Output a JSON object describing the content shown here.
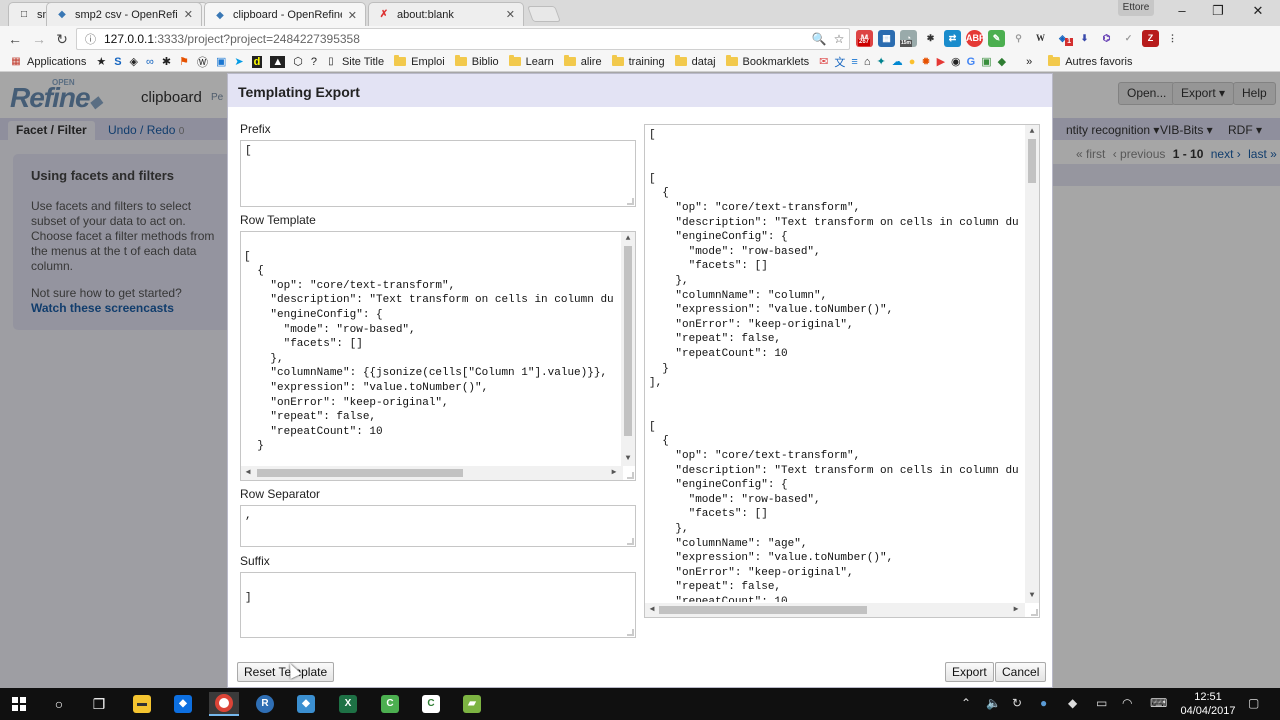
{
  "browser": {
    "tabs": [
      {
        "title": "smp2 csv - OpenRefine",
        "active": false
      },
      {
        "title": "clipboard - OpenRefine",
        "active": true
      },
      {
        "title": "about:blank",
        "active": false
      }
    ],
    "user": "Ettore",
    "url_host": "127.0.0.1",
    "url_rest": ":3333/project?project=2484227395358",
    "bookmarks_apps": "Applications",
    "bookmarks": [
      "Site Title",
      "Emploi",
      "Biblio",
      "Learn",
      "alire",
      "training",
      "dataj",
      "Bookmarklets"
    ],
    "bookmarks_more": "»",
    "bookmarks_other": "Autres favoris",
    "gmail_badge": "267",
    "ext_badge_15m": "15m",
    "ext_badge_1": "1"
  },
  "openrefine": {
    "logo": "Refine",
    "logo_top": "OPEN",
    "project_name": "clipboard",
    "permalink": "Pe",
    "header_buttons": {
      "open": "Open...",
      "export": "Export",
      "help": "Help"
    },
    "left_tabs": {
      "facet": "Facet / Filter",
      "undo": "Undo / Redo",
      "undo_count": "0"
    },
    "column_menus": [
      "ntity recognition",
      "VIB-Bits",
      "RDF"
    ],
    "help": {
      "title": "Using facets and filters",
      "para1": "Use facets and filters to select subset of your data to act on. Choose facet a filter methods from the menus at the t of each data column.",
      "para2": "Not sure how to get started?",
      "link": "Watch these screencasts"
    },
    "pager": {
      "first": "« first",
      "previous": "‹ previous",
      "range": "1 - 10",
      "next": "next ›",
      "last": "last »"
    }
  },
  "dialog": {
    "title": "Templating Export",
    "labels": {
      "prefix": "Prefix",
      "row_template": "Row Template",
      "row_separator": "Row Separator",
      "suffix": "Suffix"
    },
    "prefix_value": "[",
    "row_template_value": "\n[\n  {\n    \"op\": \"core/text-transform\",\n    \"description\": \"Text transform on cells in column du\n    \"engineConfig\": {\n      \"mode\": \"row-based\",\n      \"facets\": []\n    },\n    \"columnName\": {{jsonize(cells[\"Column 1\"].value)}},\n    \"expression\": \"value.toNumber()\",\n    \"onError\": \"keep-original\",\n    \"repeat\": false,\n    \"repeatCount\": 10\n  }",
    "row_separator_value": ",",
    "suffix_value": "\n]",
    "preview_value": "[\n\n\n[\n  {\n    \"op\": \"core/text-transform\",\n    \"description\": \"Text transform on cells in column du\n    \"engineConfig\": {\n      \"mode\": \"row-based\",\n      \"facets\": []\n    },\n    \"columnName\": \"column\",\n    \"expression\": \"value.toNumber()\",\n    \"onError\": \"keep-original\",\n    \"repeat\": false,\n    \"repeatCount\": 10\n  }\n],\n\n\n[\n  {\n    \"op\": \"core/text-transform\",\n    \"description\": \"Text transform on cells in column du\n    \"engineConfig\": {\n      \"mode\": \"row-based\",\n      \"facets\": []\n    },\n    \"columnName\": \"age\",\n    \"expression\": \"value.toNumber()\",\n    \"onError\": \"keep-original\",\n    \"repeat\": false,\n    \"repeatCount\": 10",
    "buttons": {
      "reset": "Reset Template",
      "export": "Export",
      "cancel": "Cancel"
    }
  },
  "taskbar": {
    "time": "12:51",
    "date": "04/04/2017"
  }
}
